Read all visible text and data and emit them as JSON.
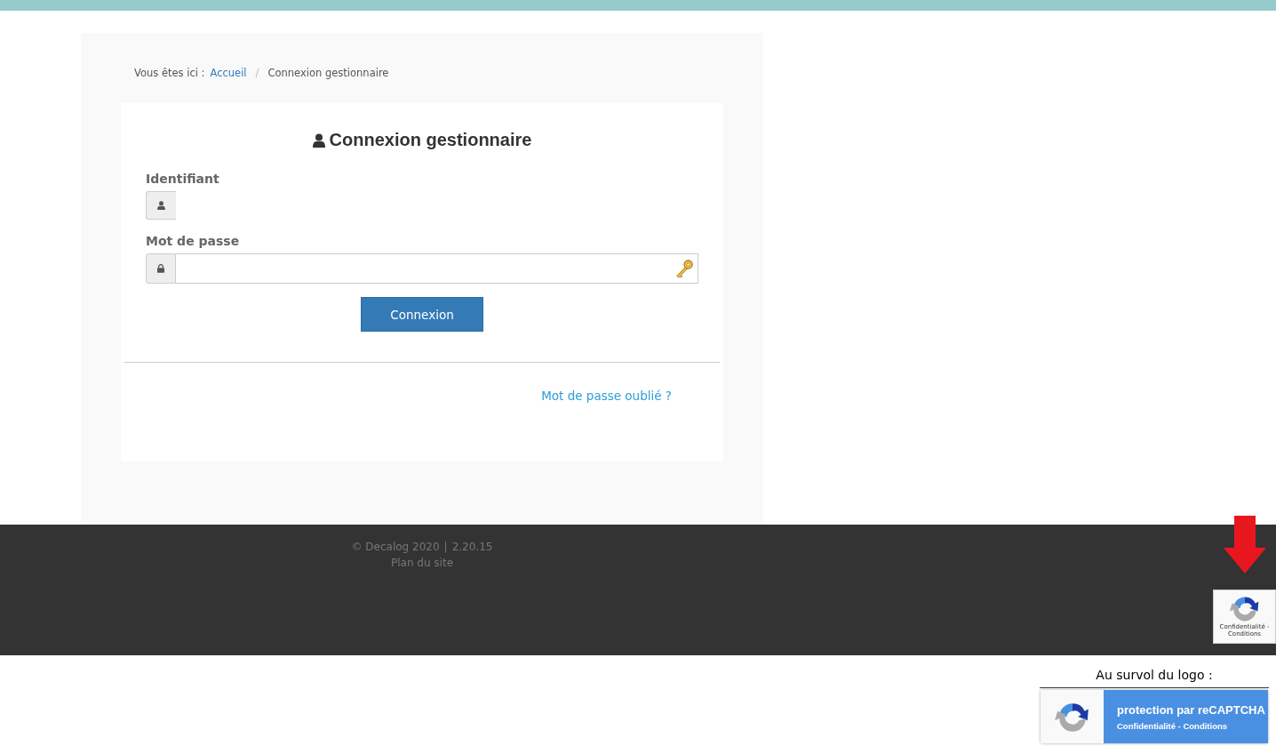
{
  "breadcrumb": {
    "prefix": "Vous êtes ici :",
    "separator": "/",
    "items": [
      {
        "label": "Accueil",
        "kind": "link"
      },
      {
        "label": "Connexion gestionnaire",
        "kind": "current"
      }
    ]
  },
  "card": {
    "title": "Connexion gestionnaire",
    "fields": [
      {
        "label": "Identifiant",
        "kind": "user"
      },
      {
        "label": "Mot de passe",
        "kind": "password"
      }
    ],
    "button": "Connexion",
    "link": "Mot de passe oublié ?"
  },
  "footer": {
    "copyright": "© Decalog 2020",
    "separator": "|",
    "version": "2.20.15",
    "sitemap": "Plan du site"
  },
  "recaptcha_badge": {
    "links": "Confidentialité - Conditions"
  },
  "hover_note": {
    "caption": "Au survol du logo :",
    "title": "protection par reCAPTCHA",
    "links": "Confidentialité - Conditions"
  }
}
